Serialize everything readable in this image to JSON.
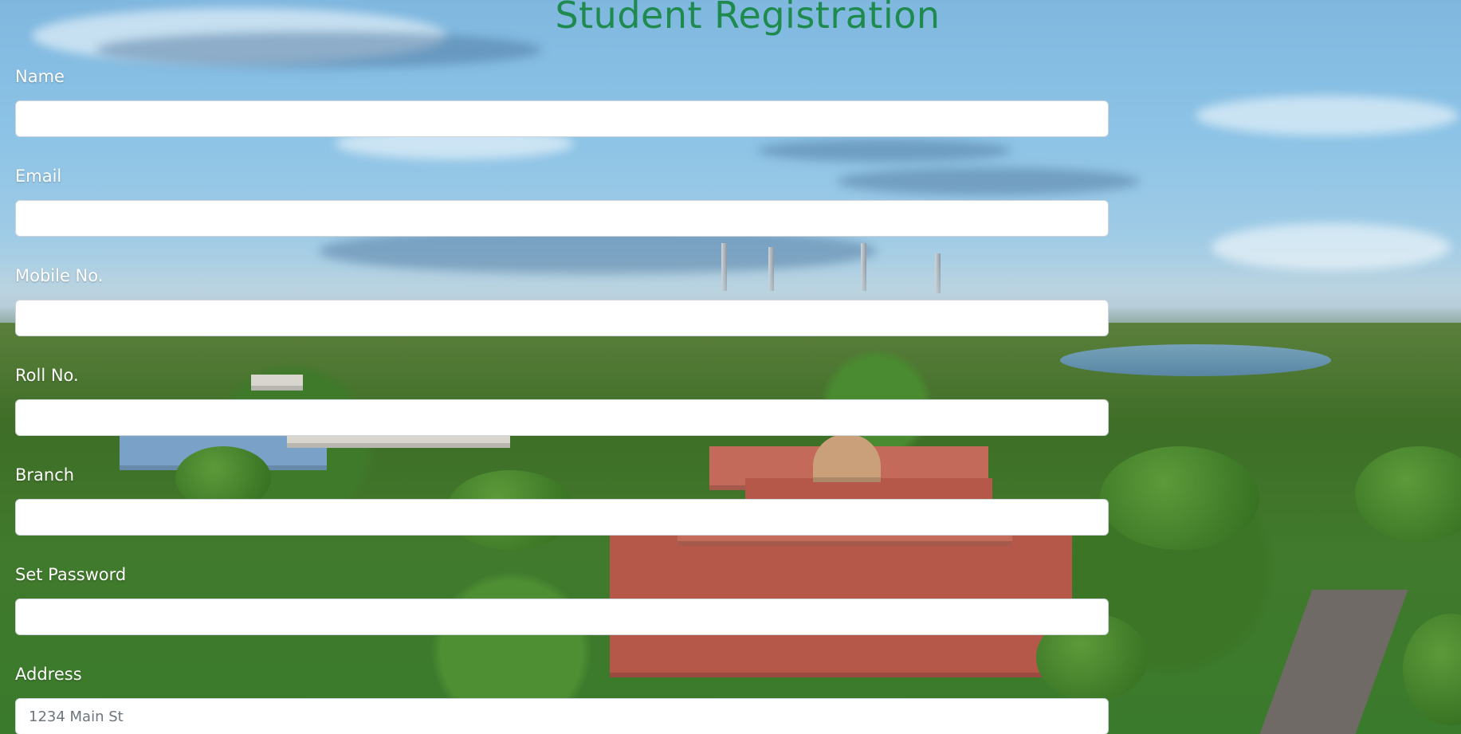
{
  "page": {
    "title": "Student Registration",
    "title_color": "#1e8a4e"
  },
  "form": {
    "fields": [
      {
        "label": "Name",
        "value": "",
        "placeholder": ""
      },
      {
        "label": "Email",
        "value": "",
        "placeholder": ""
      },
      {
        "label": "Mobile No.",
        "value": "",
        "placeholder": ""
      },
      {
        "label": "Roll No.",
        "value": "",
        "placeholder": ""
      },
      {
        "label": "Branch",
        "value": "",
        "placeholder": ""
      },
      {
        "label": "Set Password",
        "value": "",
        "placeholder": ""
      },
      {
        "label": "Address",
        "value": "",
        "placeholder": "1234 Main St"
      }
    ]
  }
}
